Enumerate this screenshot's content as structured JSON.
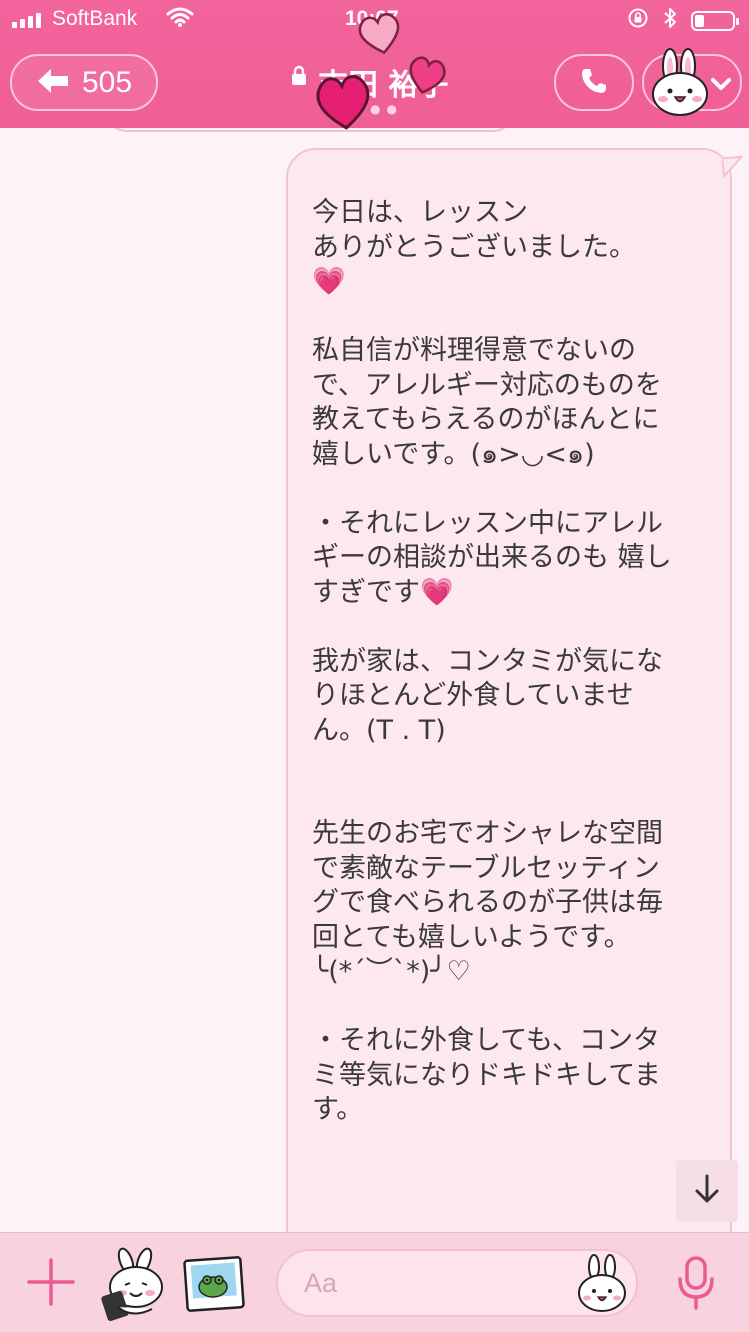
{
  "status_bar": {
    "carrier": "SoftBank",
    "time": "10:07"
  },
  "header": {
    "back_count": "505",
    "chat_name": "吉田 裕子"
  },
  "colors": {
    "header_pink": "#f2649c",
    "bubble_fill": "#fde8ef",
    "bubble_border": "#f4c3d3",
    "background": "#fdf2f5",
    "text": "#3a3a3a"
  },
  "icons": [
    "signal-icon",
    "wifi-icon",
    "rotation-lock-icon",
    "bluetooth-icon",
    "battery-icon",
    "back-arrow-icon",
    "lock-icon",
    "hearts-decoration",
    "phone-icon",
    "bunny-avatar-icon",
    "chevron-down-icon",
    "scroll-down-arrow-icon",
    "plus-icon",
    "sticker-icon",
    "photo-icon",
    "emoji-icon",
    "microphone-icon"
  ],
  "message": {
    "text": "今日は、レッスン\nありがとうございました。\n💗\n\n私自信が料理得意でないの\nで、アレルギー対応のものを\n教えてもらえるのがほんとに\n嬉しいです。(๑>◡<๑)\n\n・それにレッスン中にアレル\nギーの相談が出来るのも 嬉し\nすぎです💗\n\n我が家は、コンタミが気にな\nりほとんど外食していませ\nん。(T . T)\n\n\n先生のお宅でオシャレな空間\nで素敵なテーブルセッティン\nグで食べられるのが子供は毎\n回とても嬉しいようです。\n╰(*´︶`*)╯♡\n\n・それに外食しても、コンタ\nミ等気になりドキドキしてま\nす。"
  },
  "composer": {
    "placeholder": "Aa"
  }
}
